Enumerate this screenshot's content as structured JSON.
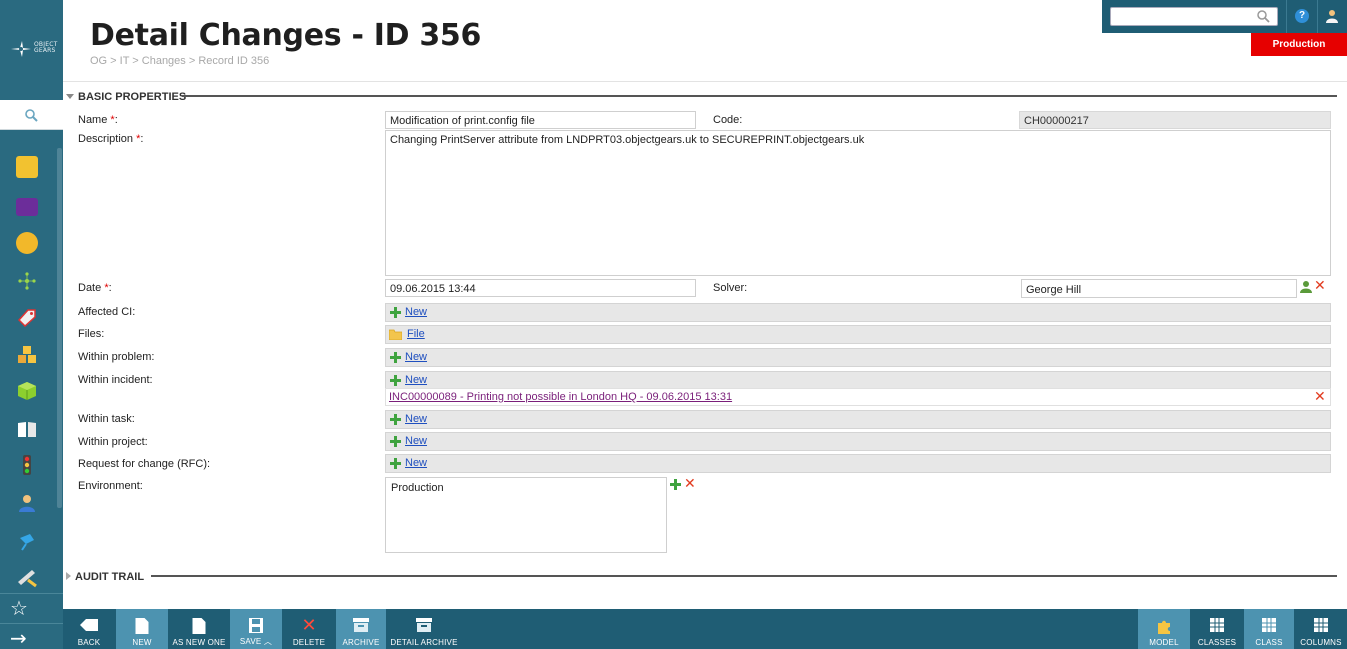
{
  "app": {
    "logo_text_1": "OBJECT",
    "logo_text_2": "GEARS"
  },
  "header": {
    "title": "Detail Changes - ID 356",
    "breadcrumb": "OG > IT > Changes > Record ID 356",
    "environment_badge": "Production",
    "search_placeholder": ""
  },
  "sections": {
    "basic": "BASIC PROPERTIES",
    "audit": "AUDIT TRAIL"
  },
  "form": {
    "name_label": "Name",
    "name_value": "Modification of print.config file",
    "code_label": "Code:",
    "code_value": "CH00000217",
    "description_label": "Description",
    "description_value": "Changing PrintServer attribute from LNDPRT03.objectgears.uk to SECUREPRINT.objectgears.uk",
    "date_label": "Date",
    "date_value": "09.06.2015 13:44",
    "solver_label": "Solver:",
    "solver_value": "George Hill",
    "required_mark": "*",
    "colon": ":",
    "affected_ci_label": "Affected CI:",
    "files_label": "Files:",
    "file_link": "File",
    "within_problem_label": "Within problem:",
    "within_incident_label": "Within incident:",
    "incident_link": "INC00000089 - Printing not possible in London HQ - 09.06.2015 13:31",
    "within_task_label": "Within task:",
    "within_project_label": "Within project:",
    "rfc_label": "Request for change (RFC):",
    "environment_label": "Environment:",
    "environment_value": "Production",
    "new_link": "New"
  },
  "toolbar": {
    "left": [
      "BACK",
      "NEW",
      "AS NEW ONE",
      "SAVE",
      "DELETE",
      "ARCHIVE",
      "DETAIL ARCHIVE"
    ],
    "right": [
      "MODEL",
      "CLASSES",
      "CLASS",
      "COLUMNS"
    ]
  },
  "sidebar_icons": [
    "folder-icon",
    "monitor-icon",
    "badge-icon",
    "network-icon",
    "tag-icon",
    "boxes-icon",
    "cube-icon",
    "book-icon",
    "traffic-light-icon",
    "person-icon",
    "pin-icon",
    "tools-icon"
  ],
  "colors": {
    "sidebar": "#2a6a80",
    "toolbar": "#1f5d74",
    "toolbar_highlight": "#4d93b0",
    "badge": "#e60000",
    "link": "#1f4fbf",
    "incident_link": "#7a1f7a"
  }
}
